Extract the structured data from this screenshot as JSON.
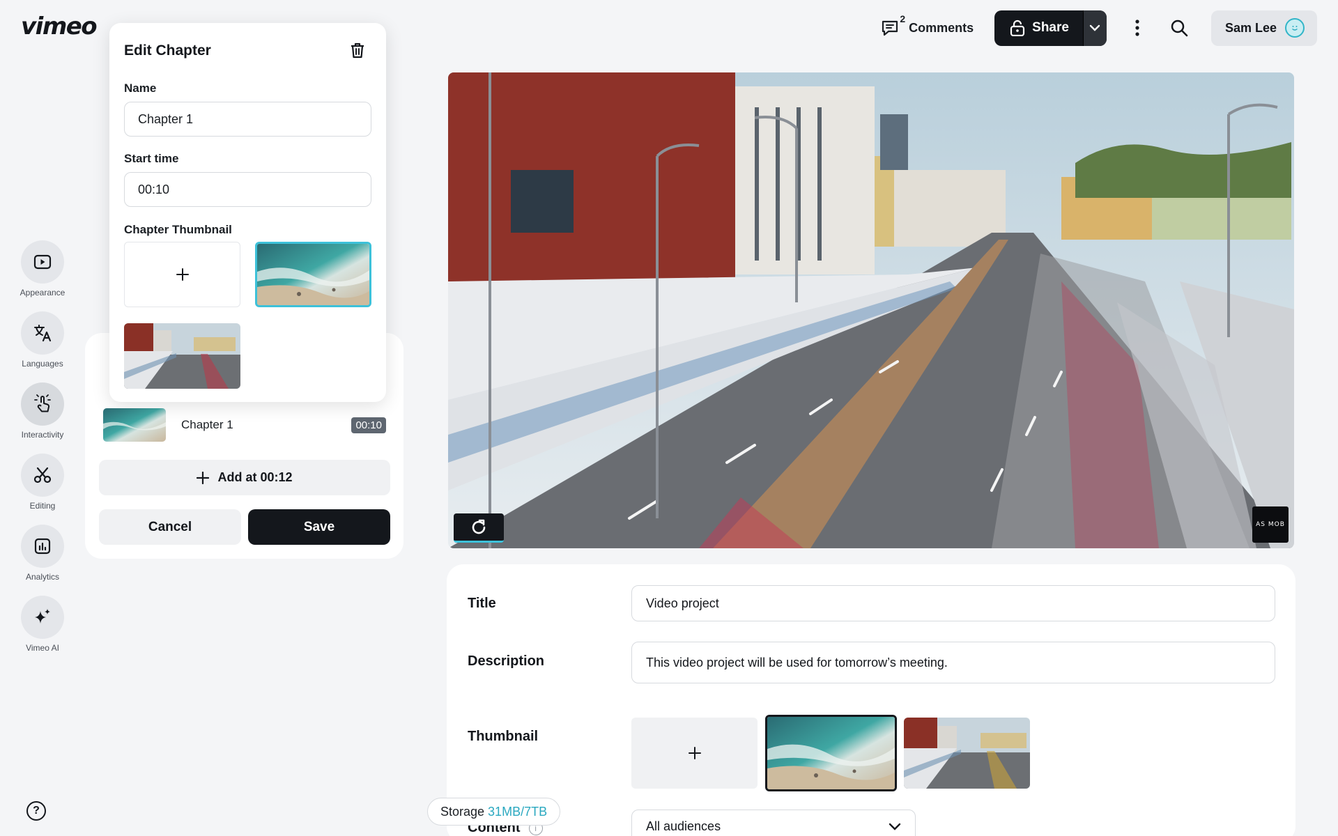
{
  "brand": {
    "logo": "vimeo"
  },
  "header": {
    "comments_label": "Comments",
    "comments_count": "2",
    "share_label": "Share",
    "user_name": "Sam Lee"
  },
  "rail": {
    "items": [
      {
        "label": "Appearance",
        "icon": "play-square-icon"
      },
      {
        "label": "Languages",
        "icon": "translate-icon"
      },
      {
        "label": "Interactivity",
        "icon": "tap-hand-icon"
      },
      {
        "label": "Editing",
        "icon": "scissors-icon"
      },
      {
        "label": "Analytics",
        "icon": "bar-chart-icon"
      },
      {
        "label": "Vimeo AI",
        "icon": "sparkle-icon"
      }
    ],
    "help_label": "?"
  },
  "edit_chapter": {
    "title": "Edit Chapter",
    "name_label": "Name",
    "name_value": "Chapter 1",
    "start_label": "Start time",
    "start_value": "00:10",
    "thumb_label": "Chapter Thumbnail"
  },
  "chapters": {
    "items": [
      {
        "name": "Chapter 1",
        "time": "00:10"
      }
    ],
    "add_label": "Add at 00:12",
    "cancel_label": "Cancel",
    "save_label": "Save"
  },
  "video": {
    "watermark": "AS MOB"
  },
  "details": {
    "title_label": "Title",
    "title_value": "Video project",
    "description_label": "Description",
    "description_value": "This video project will be used for tomorrow’s meeting.",
    "thumbnail_label": "Thumbnail",
    "content_label": "Content",
    "audience_value": "All audiences"
  },
  "storage": {
    "label": "Storage",
    "value": "31MB/7TB"
  },
  "colors": {
    "accent": "#3dc1d9",
    "primary": "#14171c",
    "background": "#f4f5f7"
  }
}
